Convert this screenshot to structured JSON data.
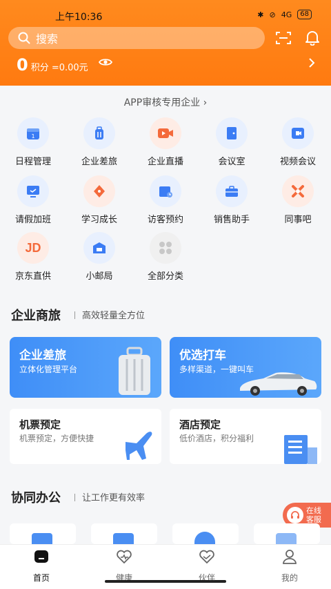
{
  "status": {
    "time": "上午10:36",
    "network": "4G",
    "battery": "68"
  },
  "search": {
    "placeholder": "搜索"
  },
  "points": {
    "value": "0",
    "label": "积分 =0.00元"
  },
  "company": {
    "name": "APP审核专用企业 ›"
  },
  "apps": [
    {
      "label": "日程管理",
      "icon": "calendar-icon",
      "bg": "#e8f0fe",
      "fg": "#3b7cf4"
    },
    {
      "label": "企业差旅",
      "icon": "suitcase-icon",
      "bg": "#e8f0fe",
      "fg": "#3b7cf4"
    },
    {
      "label": "企业直播",
      "icon": "live-video-icon",
      "bg": "#feece5",
      "fg": "#f46a3b"
    },
    {
      "label": "会议室",
      "icon": "door-icon",
      "bg": "#e8f0fe",
      "fg": "#3b7cf4"
    },
    {
      "label": "视频会议",
      "icon": "video-call-icon",
      "bg": "#e8f0fe",
      "fg": "#3b7cf4"
    },
    {
      "label": "请假加班",
      "icon": "monitor-icon",
      "bg": "#e8f0fe",
      "fg": "#3b7cf4"
    },
    {
      "label": "学习成长",
      "icon": "pen-icon",
      "bg": "#feece5",
      "fg": "#f46a3b"
    },
    {
      "label": "访客预约",
      "icon": "visitor-calendar-icon",
      "bg": "#e8f0fe",
      "fg": "#3b7cf4"
    },
    {
      "label": "销售助手",
      "icon": "briefcase-icon",
      "bg": "#e8f0fe",
      "fg": "#3b7cf4"
    },
    {
      "label": "同事吧",
      "icon": "colleague-icon",
      "bg": "#feece5",
      "fg": "#f46a3b"
    },
    {
      "label": "京东直供",
      "icon": "jd-logo-icon",
      "bg": "#feece5",
      "fg": "#f46a3b"
    },
    {
      "label": "小邮局",
      "icon": "post-office-icon",
      "bg": "#e8f0fe",
      "fg": "#3b7cf4"
    },
    {
      "label": "全部分类",
      "icon": "all-categories-icon",
      "bg": "#f0f0f0",
      "fg": "#c8c8c8"
    }
  ],
  "sections": {
    "travel": {
      "title": "企业商旅",
      "subtitle": "高效轻量全方位"
    },
    "office": {
      "title": "协同办公",
      "subtitle": "让工作更有效率"
    }
  },
  "cards": {
    "business_trip": {
      "title": "企业差旅",
      "subtitle": "立体化管理平台"
    },
    "taxi": {
      "title": "优选打车",
      "subtitle": "多样渠道，一键叫车"
    },
    "flight": {
      "title": "机票预定",
      "subtitle": "机票预定，方便快捷"
    },
    "hotel": {
      "title": "酒店预定",
      "subtitle": "低价酒店，积分福利"
    }
  },
  "service": {
    "line1": "在线",
    "line2": "客服"
  },
  "tabs": [
    {
      "label": "首页",
      "icon": "home-icon",
      "active": true
    },
    {
      "label": "健康",
      "icon": "health-icon",
      "active": false
    },
    {
      "label": "伙伴",
      "icon": "partner-icon",
      "active": false
    },
    {
      "label": "我的",
      "icon": "profile-icon",
      "active": false
    }
  ],
  "colors": {
    "brand_orange": "#ff7a10",
    "accent_blue": "#3b7cf4",
    "service_red": "#f26b4f"
  }
}
